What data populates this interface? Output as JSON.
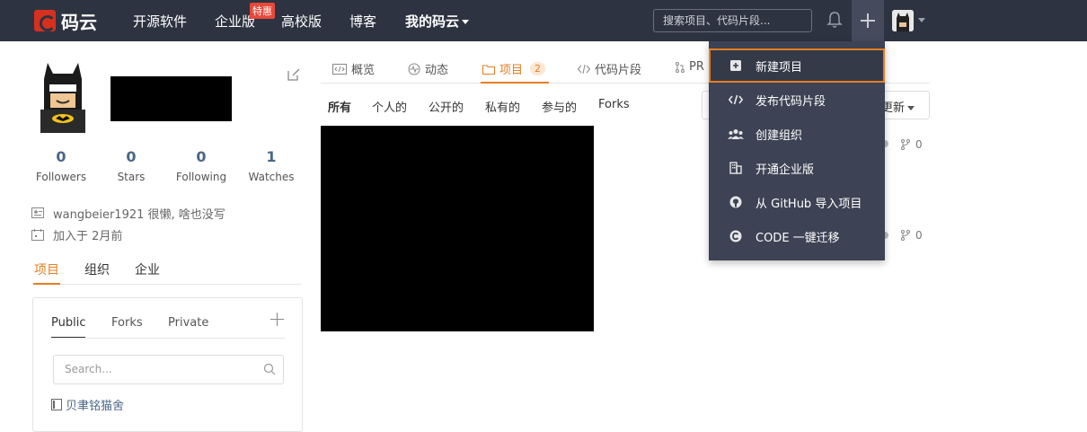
{
  "nav": {
    "logo_text": "码云",
    "links": [
      "开源软件",
      "企业版",
      "高校版",
      "博客"
    ],
    "my": "我的码云",
    "hot_badge": "特惠",
    "search_placeholder": "搜索项目、代码片段..."
  },
  "profile": {
    "stats": [
      {
        "value": "0",
        "label": "Followers"
      },
      {
        "value": "0",
        "label": "Stars"
      },
      {
        "value": "0",
        "label": "Following"
      },
      {
        "value": "1",
        "label": "Watches"
      }
    ],
    "bio": "wangbeier1921 很懒, 啥也没写",
    "joined": "加入于 2月前"
  },
  "left_tabs": [
    "项目",
    "组织",
    "企业"
  ],
  "panel": {
    "tabs": [
      "Public",
      "Forks",
      "Private"
    ],
    "search_placeholder": "Search...",
    "repo": "贝聿铭猫舍"
  },
  "main_tabs": [
    {
      "label": "概览"
    },
    {
      "label": "动态"
    },
    {
      "label": "项目",
      "count": "2"
    },
    {
      "label": "代码片段"
    },
    {
      "label": "PR"
    }
  ],
  "filters": [
    "所有",
    "个人的",
    "公开的",
    "私有的",
    "参与的",
    "Forks"
  ],
  "sort_label": "更新",
  "repo_meta": {
    "fork1": "0",
    "fork2": "0"
  },
  "dropdown": [
    {
      "label": "新建项目",
      "icon": "plus-square-icon"
    },
    {
      "label": "发布代码片段",
      "icon": "code-icon"
    },
    {
      "label": "创建组织",
      "icon": "users-icon"
    },
    {
      "label": "开通企业版",
      "icon": "building-icon"
    },
    {
      "label": "从 GitHub 导入项目",
      "icon": "github-icon"
    },
    {
      "label": "CODE 一键迁移",
      "icon": "coding-icon"
    }
  ],
  "colors": {
    "nav_bg": "#2e3341",
    "accent": "#e67e22",
    "dropdown_bg": "#3d4354"
  }
}
